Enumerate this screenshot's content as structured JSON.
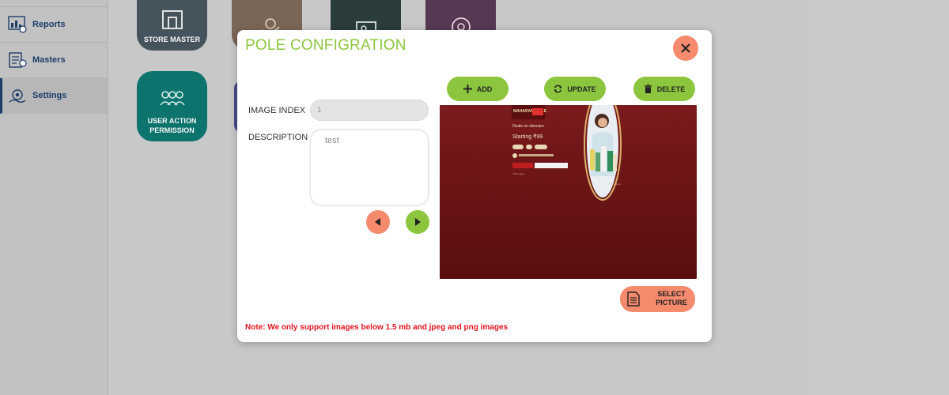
{
  "sidebar": {
    "items": [
      {
        "label": "Reports",
        "icon": "reports-icon"
      },
      {
        "label": "Masters",
        "icon": "masters-icon"
      },
      {
        "label": "Settings",
        "icon": "settings-icon",
        "active": true
      }
    ]
  },
  "tiles": [
    {
      "label": "STORE MASTER",
      "icon": "store-icon",
      "color": "#48565f"
    },
    {
      "label": "",
      "icon": "hand-coin-icon",
      "color": "#7e6a5a"
    },
    {
      "label": "",
      "icon": "device-icon",
      "color": "#2c3f3c"
    },
    {
      "label": "",
      "icon": "gauge-icon",
      "color": "#5a3a55"
    },
    {
      "label": "USER ACTION PERMISSION",
      "icon": "users-icon",
      "color": "#0d7871"
    }
  ],
  "modal": {
    "title": "POLE CONFIGRATION",
    "close_icon": "close-icon",
    "image_index": {
      "label": "IMAGE INDEX",
      "value": "1"
    },
    "description": {
      "label": "DESCRIPTION",
      "value": "test"
    },
    "actions": {
      "add": "ADD",
      "update": "UPDATE",
      "delete": "DELETE"
    },
    "select_picture": "SELECT PICTURE",
    "note": "Note: We only support images below 1.5 mb and jpeg and png images",
    "preview_text": {
      "headline": "MAHARANI SALE",
      "deal": "Deals on skincare",
      "price": "Starting ₹99"
    }
  },
  "colors": {
    "accent_green": "#8cc63f",
    "accent_salmon": "#f58a6c",
    "navy": "#1e3e6e",
    "note_red": "#e4141e",
    "preview_bg": "#6b1214"
  }
}
